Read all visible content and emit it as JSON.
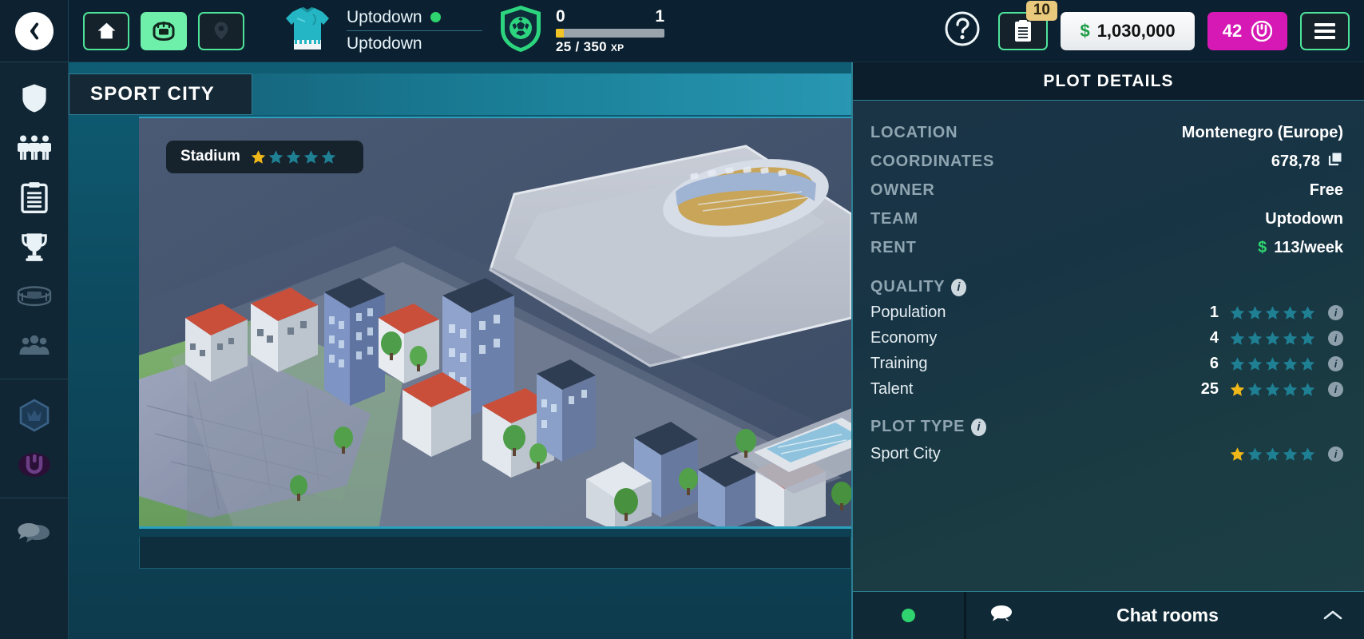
{
  "topbar": {
    "back_label": "",
    "buttons": [
      {
        "name": "home",
        "icon": "home-icon",
        "active": false
      },
      {
        "name": "stadium",
        "icon": "stadium-icon",
        "active": true
      },
      {
        "name": "map-pin",
        "icon": "location-pin-icon",
        "active": false
      }
    ],
    "team_name_top": "Uptodown",
    "team_name_bottom": "Uptodown",
    "status": "online",
    "level_current": "0",
    "level_next": "1",
    "xp_text": "25 / 350",
    "xp_unit": "XP",
    "xp_percent": 7,
    "help_icon": "question-mark-icon",
    "notes_badge": "10",
    "money_currency": "$",
    "money_amount": "1,030,000",
    "gems_amount": "42",
    "gems_symbol": "U",
    "menu_icon": "hamburger-menu-icon"
  },
  "sidebar": {
    "items": [
      {
        "name": "club",
        "icon": "shield-icon"
      },
      {
        "name": "squad",
        "icon": "players-icon"
      },
      {
        "name": "tactics",
        "icon": "clipboard-icon"
      },
      {
        "name": "competitions",
        "icon": "trophy-icon"
      },
      {
        "name": "stadium",
        "icon": "stadium-icon"
      },
      {
        "name": "fans",
        "icon": "crowd-icon"
      },
      {
        "name": "premium",
        "icon": "crown-hex-icon"
      },
      {
        "name": "uptodown",
        "icon": "u-logo-icon"
      },
      {
        "name": "chat",
        "icon": "chat-bubbles-icon"
      }
    ]
  },
  "left": {
    "title": "SPORT CITY",
    "chip_label": "Stadium",
    "chip_stars_filled": 1,
    "chip_stars_total": 5
  },
  "panel": {
    "header": "PLOT DETAILS",
    "rows": [
      {
        "key": "LOCATION",
        "value": "Montenegro (Europe)",
        "icon": null
      },
      {
        "key": "COORDINATES",
        "value": "678,78",
        "icon": "copy-icon"
      },
      {
        "key": "OWNER",
        "value": "Free",
        "icon": null
      },
      {
        "key": "TEAM",
        "value": "Uptodown",
        "icon": null
      },
      {
        "key": "RENT",
        "value": "113/week",
        "currency": "$",
        "icon": null
      }
    ],
    "quality_header": "QUALITY",
    "quality": [
      {
        "name": "Population",
        "value": "1",
        "stars_filled": 0,
        "stars_total": 5,
        "gold": false
      },
      {
        "name": "Economy",
        "value": "4",
        "stars_filled": 0,
        "stars_total": 5,
        "gold": false
      },
      {
        "name": "Training",
        "value": "6",
        "stars_filled": 0,
        "stars_total": 5,
        "gold": false
      },
      {
        "name": "Talent",
        "value": "25",
        "stars_filled": 1,
        "stars_total": 5,
        "gold": true
      }
    ],
    "plot_type_header": "PLOT TYPE",
    "plot_type": {
      "name": "Sport City",
      "stars_filled": 1,
      "stars_total": 5
    }
  },
  "chatbar": {
    "status": "online",
    "label": "Chat rooms",
    "caret": "˄",
    "chat_icon": "chat-bubble-icon"
  },
  "colors": {
    "accent_green": "#4ee39a",
    "panel_border": "#2c7f92",
    "star_gold": "#f0b719",
    "star_teal": "#1f7f93",
    "magenta": "#d618b4",
    "money_green": "#1f9e45"
  }
}
